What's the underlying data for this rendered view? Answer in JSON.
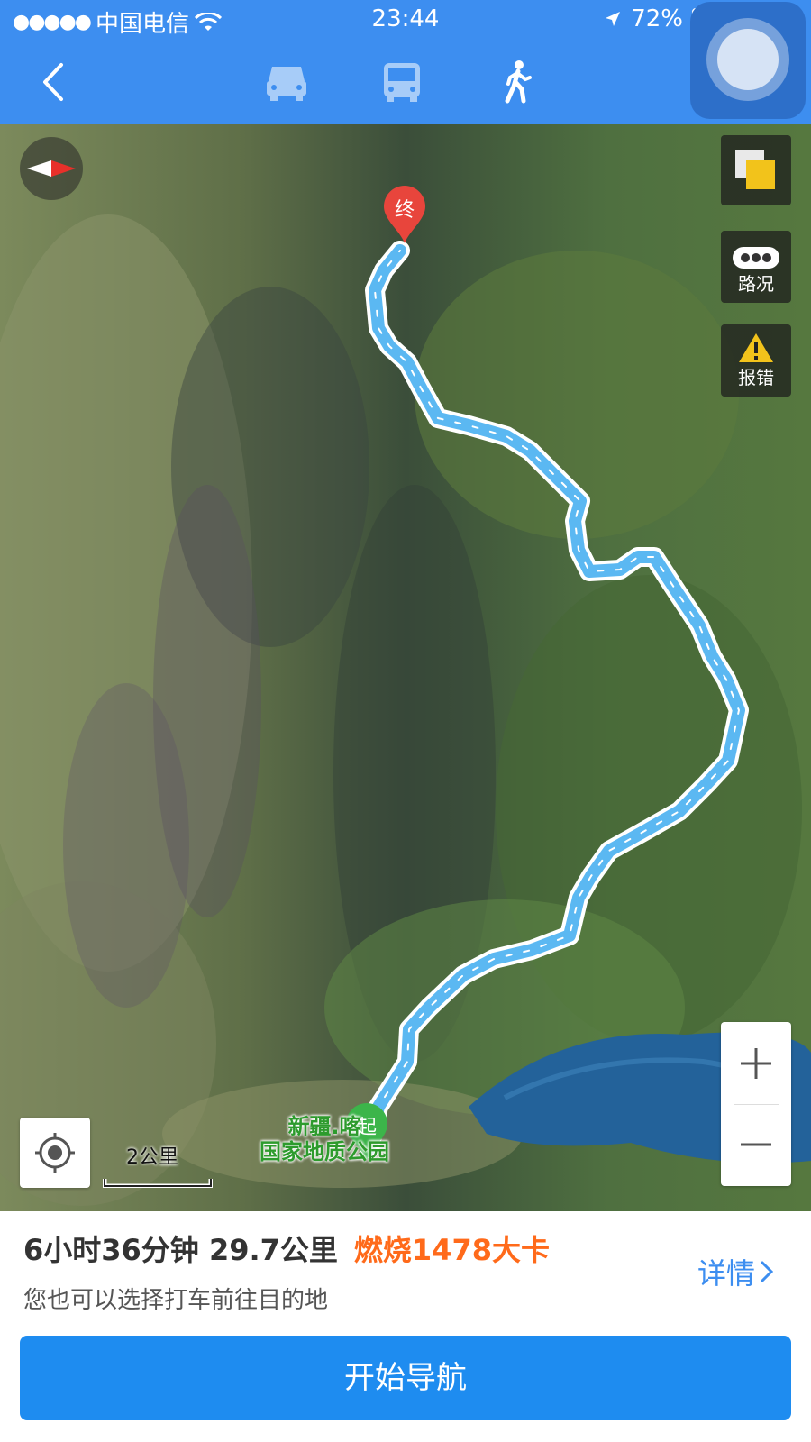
{
  "status_bar": {
    "signal_dots": "●●●●●",
    "carrier": "中国电信",
    "time": "23:44",
    "battery_percent": "72%",
    "battery_level": 0.72
  },
  "nav": {
    "modes": [
      {
        "name": "car",
        "icon": "car-icon",
        "selected": false
      },
      {
        "name": "bus",
        "icon": "bus-icon",
        "selected": false
      },
      {
        "name": "walk",
        "icon": "walk-icon",
        "selected": true
      }
    ]
  },
  "map": {
    "end_marker_label": "终",
    "start_marker_label": "起",
    "poi_line1": "新疆.喀",
    "poi_line2": "国家地质公园",
    "scale_label": "2公里",
    "buttons": {
      "layers_icon": "layers-icon",
      "traffic_label": "路况",
      "report_label": "报错"
    }
  },
  "route_panel": {
    "summary": "6小时36分钟 29.7公里",
    "calories": "燃烧1478大卡",
    "hint": "您也可以选择打车前往目的地",
    "details_label": "详情",
    "start_button_label": "开始导航"
  },
  "colors": {
    "header_blue": "#3d8ef0",
    "route_blue": "#5bb8f2",
    "start_green": "#3cb54a",
    "end_red": "#e8453c",
    "calorie_orange": "#ff6a1a"
  }
}
